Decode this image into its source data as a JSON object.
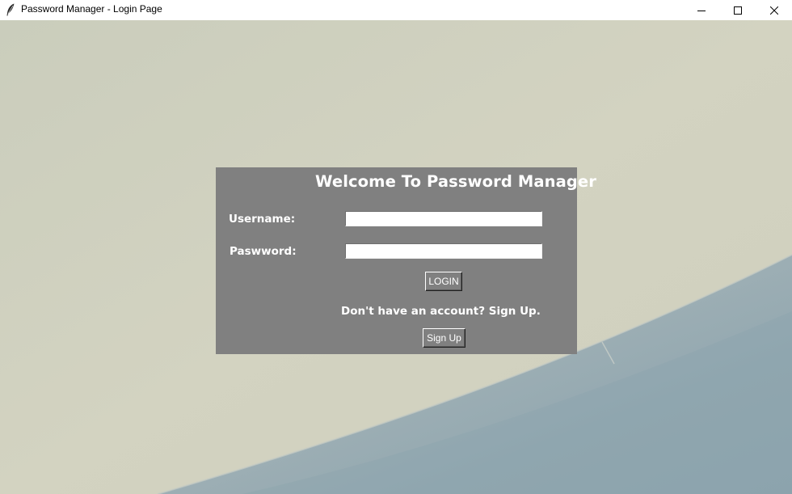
{
  "window": {
    "title": "Password Manager - Login Page",
    "icon": "feather-icon",
    "controls": {
      "minimize_icon": "minimize-icon",
      "maximize_icon": "maximize-icon",
      "close_icon": "close-icon"
    }
  },
  "login_panel": {
    "title": "Welcome To Password Manager",
    "username_label": "Username:",
    "username_value": "",
    "password_label": "Paswword:",
    "password_value": "",
    "login_button": "LOGIN",
    "signup_prompt": "Don't have an account? Sign Up.",
    "signup_button": "Sign Up"
  },
  "colors": {
    "panel_bg": "#808080",
    "panel_text": "#ffffff",
    "background_top": "#d0d0bd",
    "background_wall": "#9eb0b6"
  }
}
